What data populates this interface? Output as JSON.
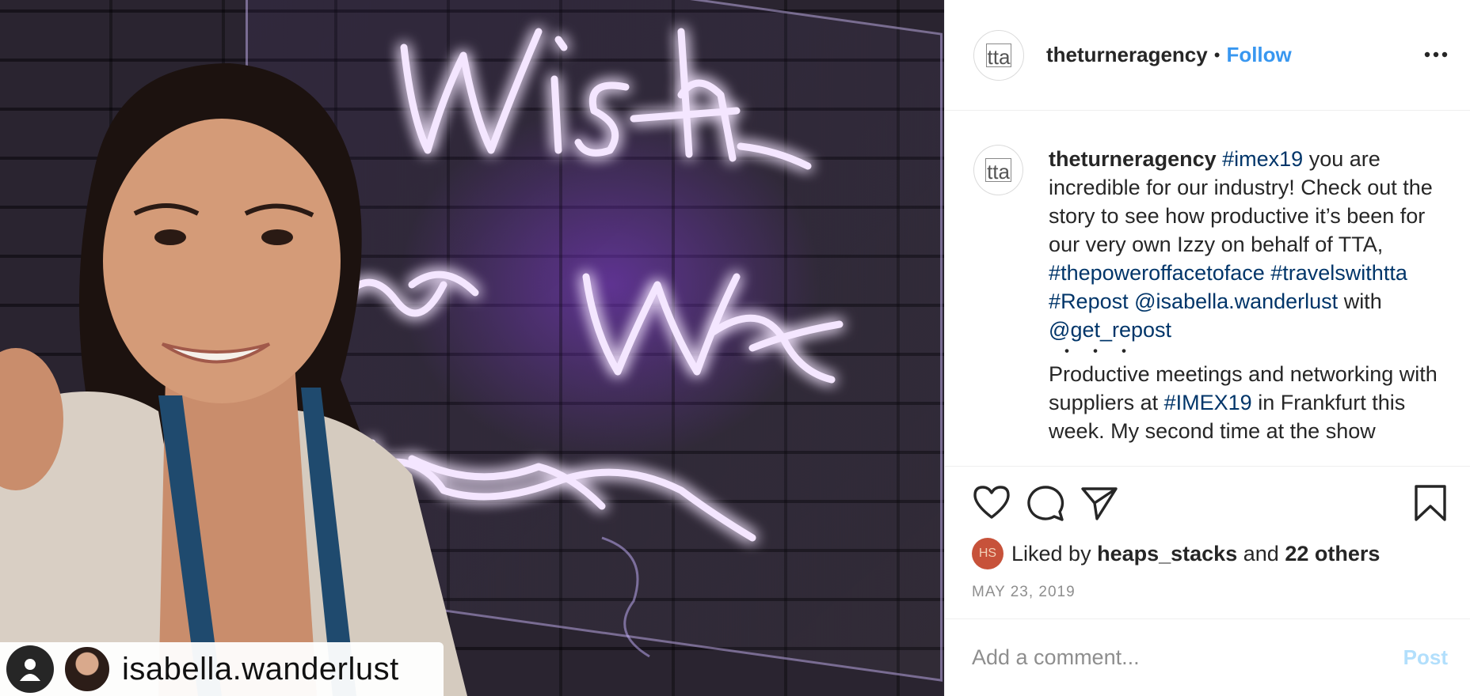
{
  "photo": {
    "repost_username": "isabella.wanderlust",
    "neon_color": "#d9a6ff"
  },
  "post": {
    "author": "theturneragency",
    "avatar_text": "tta",
    "separator": "•",
    "follow_label": "Follow",
    "more_label": "..."
  },
  "caption": {
    "author": "theturneragency",
    "segments": [
      {
        "text": "#imex19",
        "tag": true
      },
      {
        "text": " you are incredible for our industry! Check out the story to see how productive it’s been for our very own Izzy on behalf of TTA, ",
        "tag": false
      },
      {
        "text": "#thepoweroffacetoface",
        "tag": true
      },
      {
        "text": " ",
        "tag": false
      },
      {
        "text": "#travelswithtta",
        "tag": true
      },
      {
        "text": " ",
        "tag": false
      },
      {
        "text": "#Repost",
        "tag": true
      },
      {
        "text": " ",
        "tag": false
      },
      {
        "text": "@isabella.wanderlust",
        "tag": true
      },
      {
        "text": " with ",
        "tag": false
      },
      {
        "text": "@get_repost",
        "tag": true
      }
    ],
    "ellipsis": "・・・",
    "continuation": [
      {
        "text": "Productive meetings and networking with suppliers at ",
        "tag": false
      },
      {
        "text": "#IMEX19",
        "tag": true
      },
      {
        "text": " in Frankfurt this week. My second time at the show",
        "tag": false
      }
    ]
  },
  "likes": {
    "prefix": "Liked by",
    "user": "heaps_stacks",
    "joiner": "and",
    "others": "22 others",
    "avatar_initials": "HS"
  },
  "date": "MAY 23, 2019",
  "comment": {
    "placeholder": "Add a comment...",
    "post_label": "Post"
  },
  "colors": {
    "link": "#3897f0",
    "hashtag": "#003569",
    "post_disabled": "#b2dffc"
  }
}
